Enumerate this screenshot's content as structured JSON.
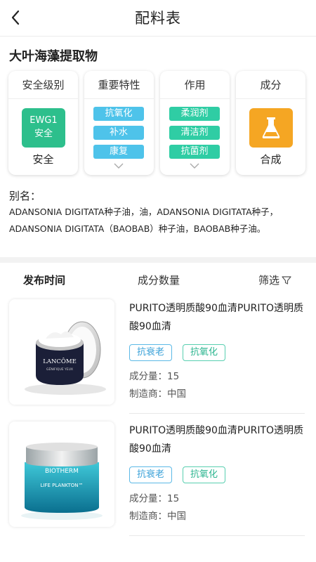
{
  "header": {
    "title": "配料表"
  },
  "ingredient": {
    "name": "大叶海藻提取物",
    "alias_label": "别名：",
    "alias_text": "ADANSONIA DIGITATA种子油，油，ADANSONIA DIGITATA种子，ADANSONIA DIGITATA（BAOBAB）种子油，BAOBAB种子油。"
  },
  "cards": {
    "safety": {
      "title": "安全级别",
      "badge_line1": "EWG1",
      "badge_line2": "安全",
      "level": "安全",
      "badge_color": "#2dbf8c"
    },
    "features": {
      "title": "重要特性",
      "tags": [
        "抗氧化",
        "补水",
        "康复"
      ],
      "tag_color": "#4ec3ea"
    },
    "functions": {
      "title": "作用",
      "tags": [
        "柔润剂",
        "清洁剂",
        "抗菌剂"
      ],
      "tag_color": "#2fcda4"
    },
    "composition": {
      "title": "成分",
      "icon": "flask-icon",
      "value": "合成",
      "icon_bg": "#f5a623"
    }
  },
  "filter_bar": {
    "publish_time": "发布时间",
    "ingredient_count": "成分数量",
    "filter": "筛选"
  },
  "products": [
    {
      "title": "PURITO透明质酸90血清PURITO透明质酸90血清",
      "tags": [
        "抗衰老",
        "抗氧化"
      ],
      "count_label": "成分量：",
      "count": "15",
      "maker_label": "制造商：",
      "maker": "中国",
      "brand_on_image": "LANCÔME",
      "product_line_on_image": "GÉNIFIQUE YEUX"
    },
    {
      "title": "PURITO透明质酸90血清PURITO透明质酸90血清",
      "tags": [
        "抗衰老",
        "抗氧化"
      ],
      "count_label": "成分量：",
      "count": "15",
      "maker_label": "制造商：",
      "maker": "中国",
      "brand_on_image": "BIOTHERM",
      "product_line_on_image": "LIFE PLANKTON™"
    }
  ]
}
